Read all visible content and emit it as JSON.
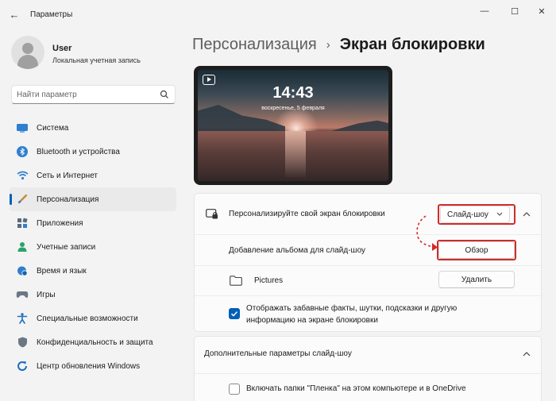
{
  "window": {
    "title": "Параметры",
    "back_glyph": "←",
    "minimize_glyph": "—",
    "maximize_glyph": "☐",
    "close_glyph": "✕"
  },
  "user": {
    "name": "User",
    "account_type": "Локальная учетная запись"
  },
  "search": {
    "placeholder": "Найти параметр"
  },
  "sidebar": {
    "items": [
      {
        "label": "Система",
        "icon": "system-icon",
        "active": false
      },
      {
        "label": "Bluetooth и устройства",
        "icon": "bluetooth-icon",
        "active": false
      },
      {
        "label": "Сеть и Интернет",
        "icon": "wifi-icon",
        "active": false
      },
      {
        "label": "Персонализация",
        "icon": "brush-icon",
        "active": true
      },
      {
        "label": "Приложения",
        "icon": "apps-icon",
        "active": false
      },
      {
        "label": "Учетные записи",
        "icon": "accounts-icon",
        "active": false
      },
      {
        "label": "Время и язык",
        "icon": "globe-clock-icon",
        "active": false
      },
      {
        "label": "Игры",
        "icon": "gamepad-icon",
        "active": false
      },
      {
        "label": "Специальные возможности",
        "icon": "accessibility-icon",
        "active": false
      },
      {
        "label": "Конфиденциальность и защита",
        "icon": "shield-icon",
        "active": false
      },
      {
        "label": "Центр обновления Windows",
        "icon": "update-icon",
        "active": false
      }
    ]
  },
  "breadcrumb": {
    "parent": "Персонализация",
    "separator": "›",
    "current": "Экран блокировки"
  },
  "preview": {
    "time": "14:43",
    "date": "воскресенье, 5 февраля"
  },
  "lock_screen_card": {
    "label": "Персонализируйте свой экран блокировки",
    "dropdown_value": "Слайд-шоу",
    "add_album": {
      "label": "Добавление альбома для слайд-шоу",
      "button": "Обзор"
    },
    "folder": {
      "name": "Pictures",
      "button": "Удалить"
    },
    "fun_facts": {
      "checked": true,
      "line1": "Отображать забавные факты, шутки, подсказки и другую",
      "line2": "информацию на экране блокировки"
    }
  },
  "slideshow_card": {
    "header": "Дополнительные параметры слайд-шоу",
    "camera_roll": {
      "checked": false,
      "label": "Включать папки \"Пленка\" на этом компьютере и в OneDrive"
    }
  },
  "colors": {
    "accent": "#005fb8",
    "highlight": "#d02b2b",
    "background": "#f3f3f3",
    "card": "#fbfbfb"
  }
}
